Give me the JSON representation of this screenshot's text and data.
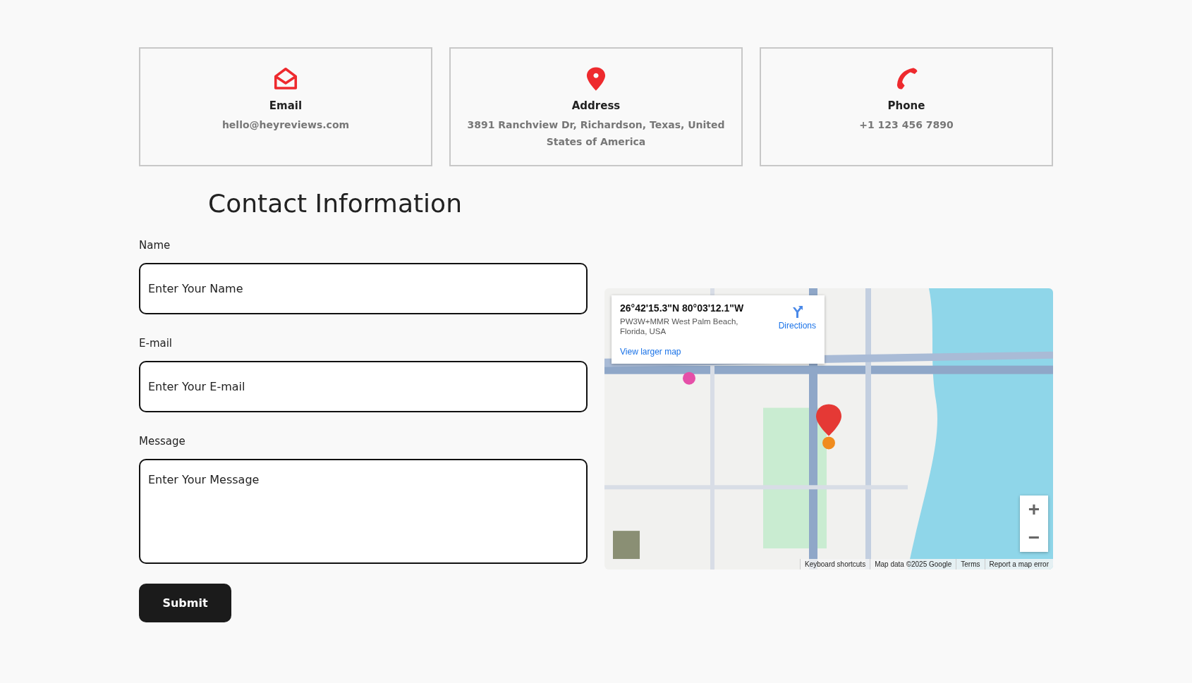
{
  "info_cards": [
    {
      "kind": "email",
      "title": "Email",
      "text": "hello@heyreviews.com"
    },
    {
      "kind": "address",
      "title": "Address",
      "text": "3891 Ranchview Dr, Richardson, Texas, United States of America"
    },
    {
      "kind": "phone",
      "title": "Phone",
      "text": "+1 123 456 7890"
    }
  ],
  "heading": "Contact Information",
  "form": {
    "fields": [
      {
        "kind": "input",
        "label": "Name",
        "placeholder": "Enter Your Name"
      },
      {
        "kind": "input",
        "label": "E-mail",
        "placeholder": "Enter Your E-mail"
      },
      {
        "kind": "textarea",
        "label": "Message",
        "placeholder": "Enter Your Message"
      }
    ],
    "submit": "Submit"
  },
  "map": {
    "kind": "picture",
    "place_card": {
      "coordinates": "26°42'15.3\"N 80°03'12.1\"W",
      "address": "PW3W+MMR West Palm Beach, Florida, USA",
      "directions": "Directions",
      "larger_map": "View larger map"
    },
    "zoom_in": "+",
    "zoom_out": "−",
    "footer": [
      "Keyboard shortcuts",
      "Map data ©2025 Google",
      "Terms",
      "Report a map error"
    ]
  }
}
